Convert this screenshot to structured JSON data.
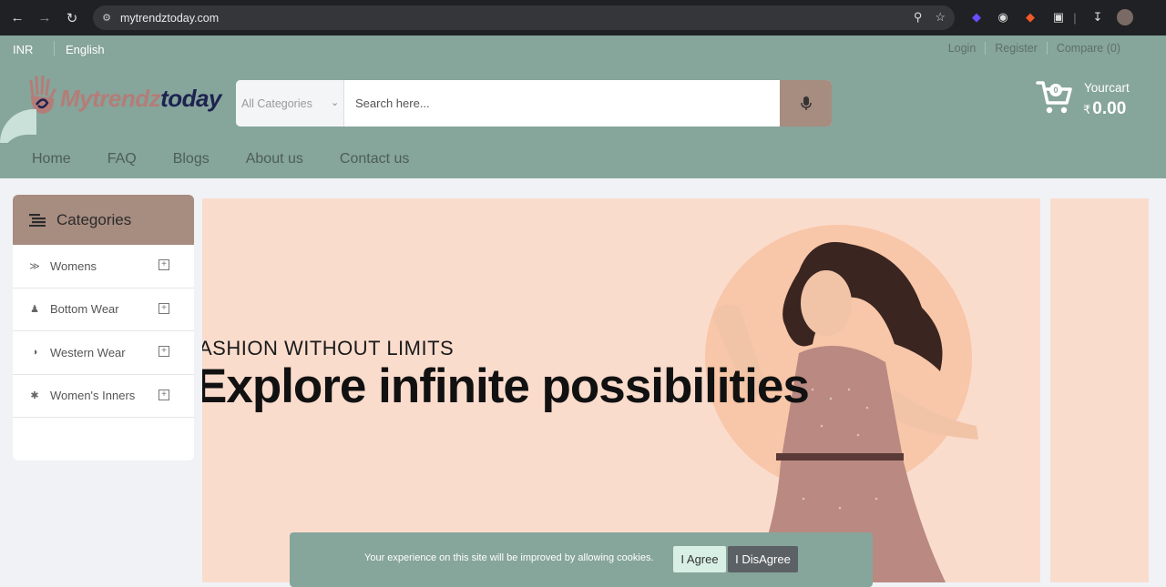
{
  "browser": {
    "url": "mytrendztoday.com"
  },
  "topbar": {
    "currency": "INR",
    "language": "English",
    "links": [
      "Login",
      "Register",
      "Compare (0)"
    ]
  },
  "logo": {
    "text_part1": "Mytrendz",
    "text_part2": "today"
  },
  "search": {
    "category_selected": "All Categories",
    "placeholder": "Search here..."
  },
  "cart": {
    "count": "0",
    "label": "Yourcart",
    "currency_symbol": "₹",
    "amount": "0.00"
  },
  "menu": [
    "Home",
    "FAQ",
    "Blogs",
    "About us",
    "Contact us"
  ],
  "sidebar": {
    "title": "Categories",
    "items": [
      {
        "label": "Womens",
        "icon": "rss-icon"
      },
      {
        "label": "Bottom Wear",
        "icon": "figure-icon"
      },
      {
        "label": "Western Wear",
        "icon": "half-circle-icon"
      },
      {
        "label": "Women's Inners",
        "icon": "asterisk-icon"
      }
    ]
  },
  "banner": {
    "eyebrow": "ASHION WITHOUT LIMITS",
    "headline": "Explore infinite possibilities"
  },
  "cookie": {
    "text": "Your experience on this site will be improved by allowing cookies.",
    "agree_label": "I Agree",
    "disagree_label": "I DisAgree"
  },
  "colors": {
    "brand_teal": "#86a59b",
    "brand_mauve": "#a78c80",
    "banner_bg": "#fadccd"
  }
}
